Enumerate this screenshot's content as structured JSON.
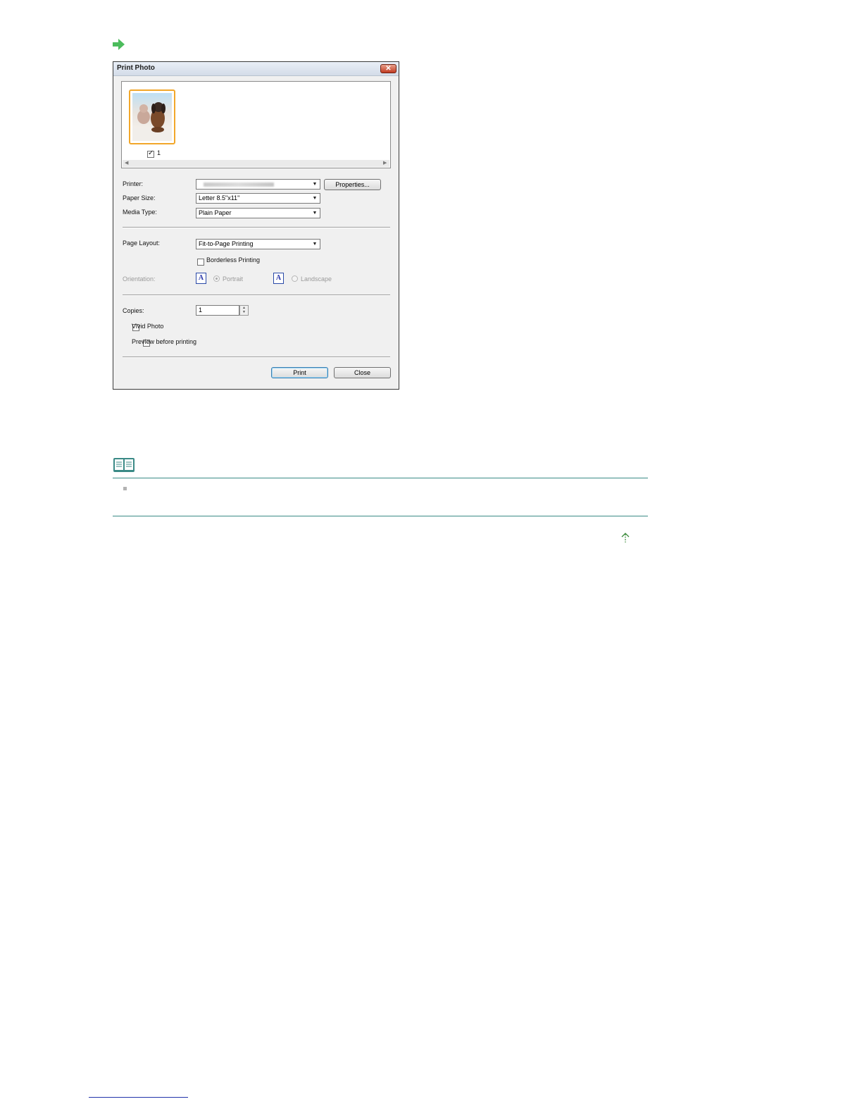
{
  "dialog": {
    "title": "Print Photo",
    "close_glyph": "✕",
    "thumbnail": {
      "number": "1",
      "checked": true
    },
    "printer": {
      "label": "Printer:",
      "value": "",
      "properties_button": "Properties..."
    },
    "paper_size": {
      "label": "Paper Size:",
      "value": "Letter 8.5\"x11\""
    },
    "media_type": {
      "label": "Media Type:",
      "value": "Plain Paper"
    },
    "page_layout": {
      "label": "Page Layout:",
      "value": "Fit-to-Page Printing"
    },
    "borderless": {
      "label": "Borderless Printing",
      "checked": false
    },
    "orientation": {
      "label": "Orientation:",
      "icon_letter": "A",
      "portrait": "Portrait",
      "landscape": "Landscape",
      "selected": "Portrait"
    },
    "copies": {
      "label": "Copies:",
      "value": "1"
    },
    "vivid_photo": {
      "label": "Vivid Photo",
      "checked": false
    },
    "preview": {
      "label": "Preview before printing",
      "checked": false
    },
    "print_button": "Print",
    "close_button": "Close"
  },
  "icons": {
    "arrow": "green-arrow-icon",
    "note": "book-icon",
    "top": "up-arrow-icon"
  },
  "colors": {
    "arrow_green": "#4cbc5c",
    "note_rule": "#3a8a86",
    "thumbnail_border": "#f2a72a"
  }
}
